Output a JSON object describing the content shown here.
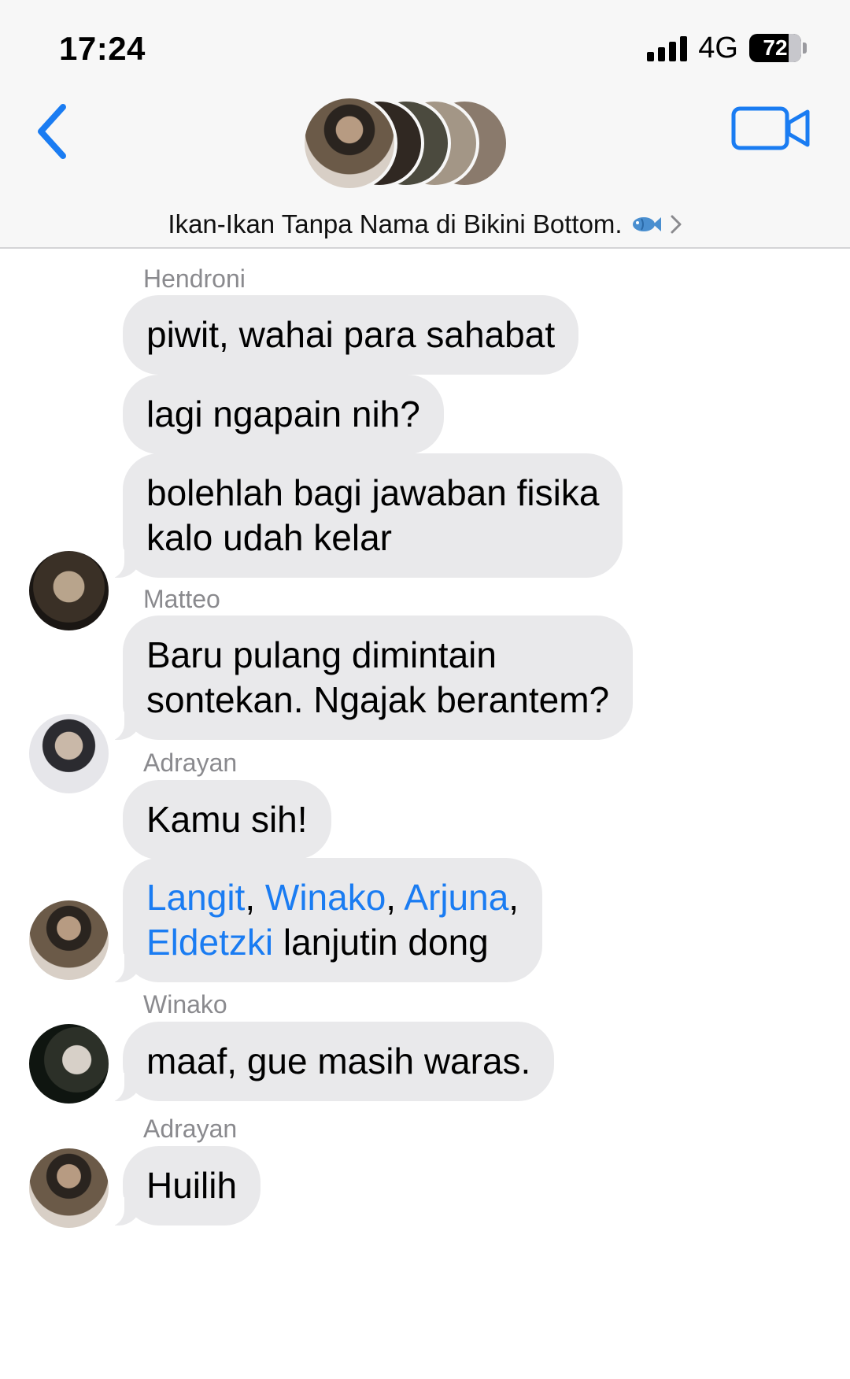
{
  "status_bar": {
    "time": "17:24",
    "network": "4G",
    "battery_percent": "72",
    "signal_bars": 4
  },
  "header": {
    "back_icon": "chevron-left-icon",
    "video_icon": "video-camera-icon",
    "group_name": "Ikan-Ikan Tanpa Nama di Bikini Bottom.",
    "group_emoji_icon": "fish-icon",
    "accent_color": "#1a7cf2"
  },
  "messages": [
    {
      "sender": "Hendroni",
      "bubbles": [
        "piwit, wahai para sahabat",
        "lagi ngapain nih?"
      ],
      "last_bubble_lines": [
        "bolehlah bagi jawaban fisika",
        "kalo udah kelar"
      ]
    },
    {
      "sender": "Matteo",
      "last_bubble_lines": [
        "Baru pulang dimintain",
        "sontekan. Ngajak berantem?"
      ]
    },
    {
      "sender": "Adrayan",
      "bubbles": [
        "Kamu sih!"
      ],
      "mentions": [
        "Langit",
        "Winako",
        "Arjuna",
        "Eldetzki"
      ],
      "separator": ",",
      "mention_tail": "lanjutin dong"
    },
    {
      "sender": "Winako",
      "bubbles": [
        "maaf, gue masih waras."
      ]
    },
    {
      "sender": "Adrayan",
      "bubbles": [
        "Huilih"
      ]
    }
  ],
  "colors": {
    "bubble_bg": "#e9e9eb",
    "sender_name": "#8a8a8e",
    "mention": "#1a7cf2",
    "header_bg": "#f7f7f7"
  }
}
